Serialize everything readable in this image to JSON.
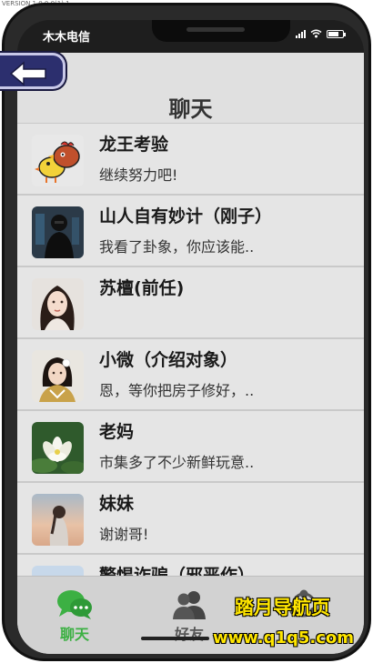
{
  "version_text": "VERSION 1.0.0.0(1) 1",
  "status": {
    "carrier": "木木电信"
  },
  "header": {
    "title": "聊天"
  },
  "chats": [
    {
      "name": "龙王考验",
      "message": "继续努力吧!",
      "avatar": "chicken-cartoon-avatar"
    },
    {
      "name": "山人自有妙计（刚子）",
      "message": "我看了卦象，你应该能..",
      "avatar": "dark-figure-avatar"
    },
    {
      "name": "苏檀(前任)",
      "message": "",
      "avatar": "woman-portrait-avatar"
    },
    {
      "name": "小微（介绍对象）",
      "message": "恩，等你把房子修好，..",
      "avatar": "woman-traditional-avatar"
    },
    {
      "name": "老妈",
      "message": "市集多了不少新鲜玩意..",
      "avatar": "lotus-flower-avatar"
    },
    {
      "name": "妹妹",
      "message": "谢谢哥!",
      "avatar": "girl-sunset-avatar"
    },
    {
      "name": "警惕诈骗（邪恶作）",
      "message": "",
      "avatar": "sky-avatar"
    }
  ],
  "tabs": [
    {
      "label": "聊天",
      "icon": "chat-bubbles-icon",
      "active": true
    },
    {
      "label": "好友",
      "icon": "friends-icon",
      "active": false
    },
    {
      "label": "",
      "icon": "group-icon",
      "active": false
    }
  ],
  "watermark": {
    "title": "踏月导航页",
    "url": "www.q1q5.com"
  },
  "colors": {
    "active_tab": "#3cb043",
    "inactive_tab": "#555555",
    "header_bg": "#e0e0e0",
    "list_bg": "#e5e5e5",
    "watermark": "#ffe600"
  }
}
